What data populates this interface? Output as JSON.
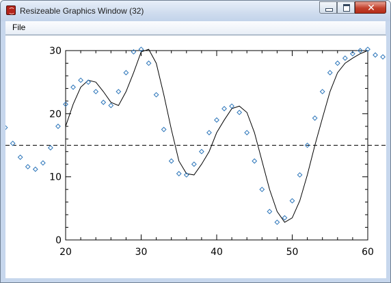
{
  "window": {
    "title": "Resizeable Graphics Window (32)",
    "icon": "idl-app-icon",
    "buttons": {
      "minimize": "minimize-icon",
      "maximize": "maximize-icon",
      "close": "close-icon",
      "close_glyph": "✕"
    }
  },
  "menu": {
    "items": [
      {
        "label": "File"
      }
    ]
  },
  "chart_data": {
    "type": "scatter",
    "title": "",
    "xlabel": "",
    "ylabel": "",
    "xlim": [
      20,
      60
    ],
    "ylim": [
      0,
      30
    ],
    "x_ticks": [
      20,
      30,
      40,
      50,
      60
    ],
    "y_ticks": [
      0,
      10,
      20,
      30
    ],
    "x_tick_labels": [
      "20",
      "30",
      "40",
      "50",
      "60"
    ],
    "y_tick_labels": [
      "0",
      "10",
      "20",
      "30"
    ],
    "grid": false,
    "reference_line": {
      "y": 15,
      "style": "dashed",
      "color": "#000000"
    },
    "series": [
      {
        "kind": "line",
        "color": "#000000",
        "x": [
          20,
          21,
          22,
          23,
          24,
          25,
          26,
          27,
          28,
          29,
          30,
          31,
          32,
          33,
          34,
          35,
          36,
          37,
          38,
          39,
          40,
          41,
          42,
          43,
          44,
          45,
          46,
          47,
          48,
          49,
          50,
          51,
          52,
          53,
          54,
          55,
          56,
          57,
          58,
          59,
          60
        ],
        "y": [
          18.0,
          21.5,
          24.2,
          25.3,
          25.0,
          23.5,
          21.8,
          21.3,
          23.5,
          26.5,
          29.8,
          30.2,
          28.0,
          23.0,
          17.5,
          12.5,
          10.5,
          10.3,
          12.0,
          14.0,
          17.0,
          19.0,
          20.8,
          21.2,
          20.2,
          17.0,
          12.5,
          8.0,
          4.5,
          2.8,
          3.5,
          6.2,
          10.3,
          15.0,
          19.3,
          23.5,
          26.5,
          28.0,
          28.8,
          29.5,
          30.0
        ]
      },
      {
        "kind": "markers",
        "marker": "diamond",
        "color": "#2a74b9",
        "x": [
          11,
          12,
          13,
          14,
          15,
          16,
          17,
          18,
          19,
          20,
          21,
          22,
          23,
          24,
          25,
          26,
          27,
          28,
          29,
          30,
          31,
          32,
          33,
          34,
          35,
          36,
          37,
          38,
          39,
          40,
          41,
          42,
          43,
          44,
          45,
          46,
          47,
          48,
          49,
          50,
          51,
          52,
          53,
          54,
          55,
          56,
          57,
          58,
          59,
          60,
          61,
          62
        ],
        "y": [
          19.5,
          17.8,
          15.3,
          13.1,
          11.6,
          11.2,
          12.2,
          14.6,
          18.0,
          21.5,
          24.2,
          25.3,
          25.0,
          23.5,
          21.8,
          21.3,
          23.5,
          26.5,
          29.8,
          30.2,
          28.0,
          23.0,
          17.5,
          12.5,
          10.5,
          10.3,
          12.0,
          14.0,
          17.0,
          19.0,
          20.8,
          21.2,
          20.2,
          17.0,
          12.5,
          8.0,
          4.5,
          2.8,
          3.5,
          6.2,
          10.3,
          15.0,
          19.3,
          23.5,
          26.5,
          28.0,
          28.8,
          29.5,
          30.0,
          30.2,
          29.3,
          29.0
        ]
      }
    ]
  }
}
